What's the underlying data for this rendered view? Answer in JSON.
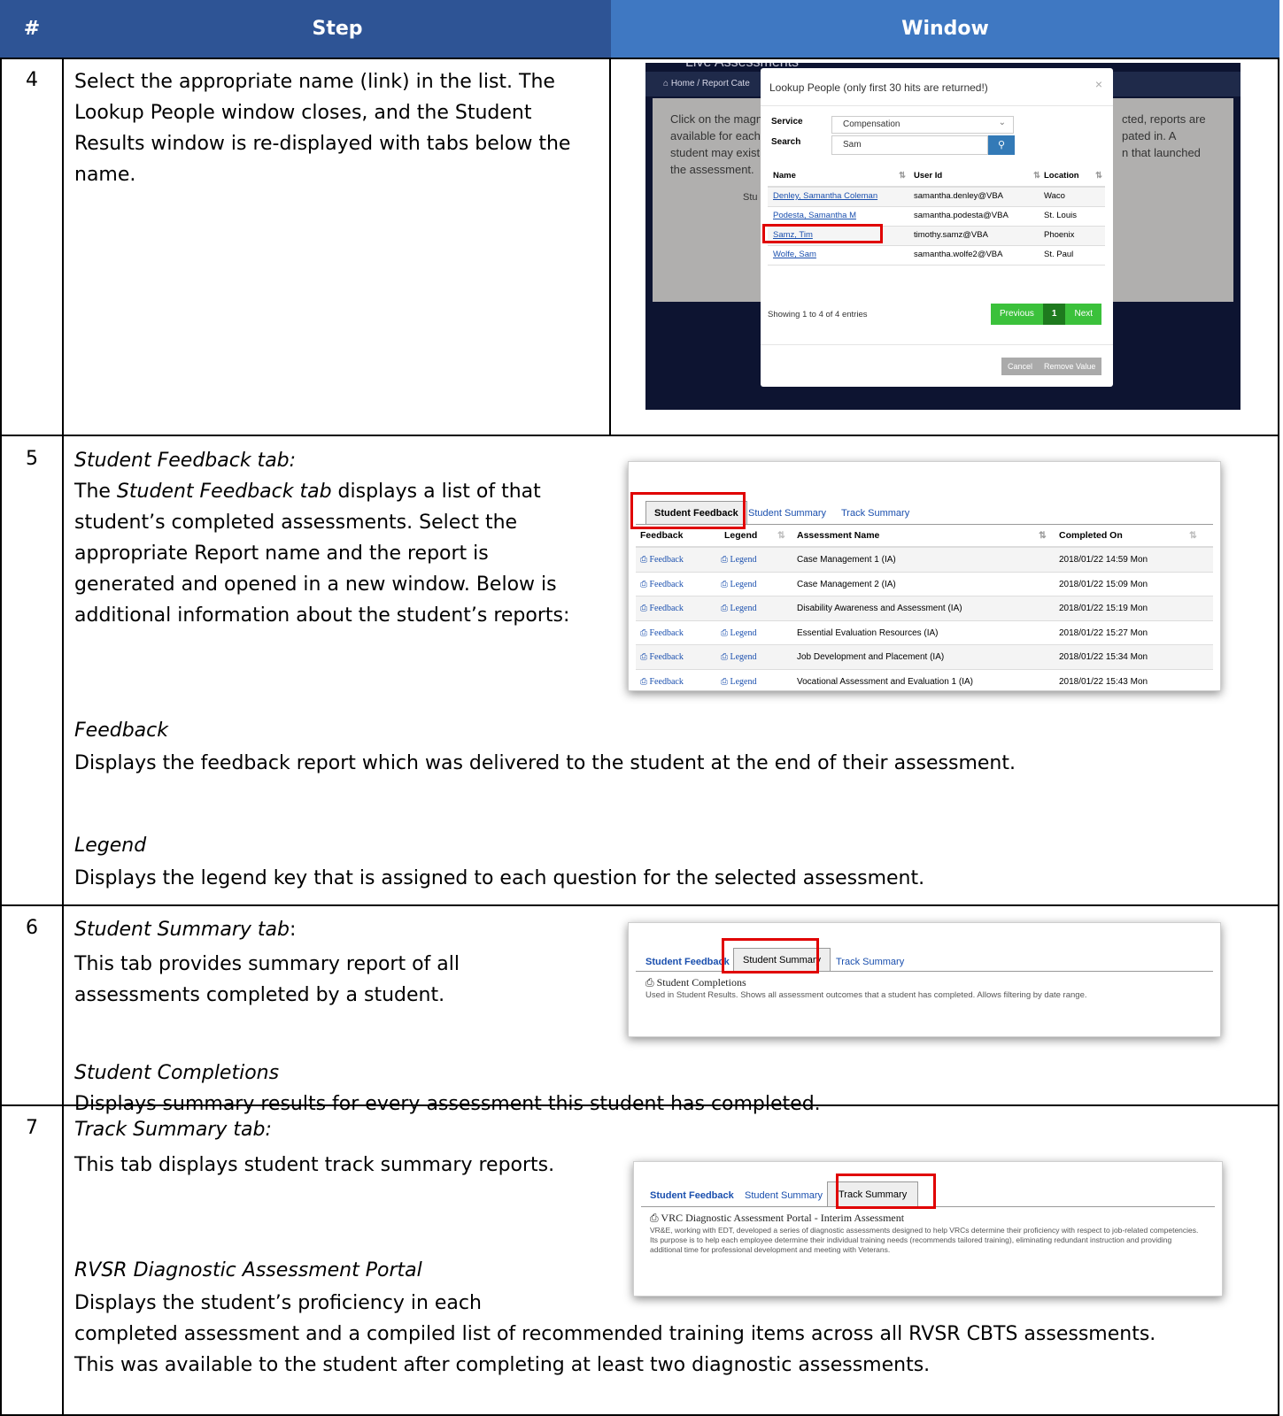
{
  "header": {
    "num": "#",
    "step": "Step",
    "window": "Window"
  },
  "rows": [
    {
      "num": "4",
      "text": "Select the appropriate name (link) in the list.  The Lookup People window closes, and the Student Results window is re-displayed with tabs below the name.",
      "screenshot": {
        "bg_title": "Live Assessments",
        "breadcrumb": "Home  /  Report Cate",
        "bg_text": [
          "Click on the magn",
          "available for each",
          "student may exist",
          "the assessment."
        ],
        "bg_text_right": [
          "cted, reports are",
          "pated in. A",
          "n that launched"
        ],
        "bg_stub": "Stu",
        "modal_title": "Lookup People (only first 30 hits are returned!)",
        "close": "×",
        "service_label": "Service",
        "service_value": "Compensation",
        "search_label": "Search",
        "search_value": "Sam",
        "columns": [
          "Name",
          "User Id",
          "Location"
        ],
        "people": [
          {
            "name": "Denley, Samantha Coleman",
            "user": "samantha.denley@VBA",
            "loc": "Waco"
          },
          {
            "name": "Podesta, Samantha M",
            "user": "samantha.podesta@VBA",
            "loc": "St. Louis"
          },
          {
            "name": "Samz, Tim",
            "user": "timothy.samz@VBA",
            "loc": "Phoenix"
          },
          {
            "name": "Wolfe, Sam",
            "user": "samantha.wolfe2@VBA",
            "loc": "St. Paul"
          }
        ],
        "showing": "Showing 1 to 4 of 4 entries",
        "prev": "Previous",
        "page": "1",
        "next": "Next",
        "cancel": "Cancel",
        "remove": "Remove Value"
      }
    },
    {
      "num": "5",
      "tab_title": "Student Feedback tab:",
      "text_pre": "The ",
      "text_ital": "Student Feedback tab",
      "text_post": " displays a list of that student’s completed assessments.  Select the appropriate Report name and the report is generated and opened in a new window.  Below is additional information about the student’s reports:",
      "sub1_title": "Feedback",
      "sub1_text": "Displays the feedback report which was delivered to the student at the end of their assessment.",
      "sub2_title": "Legend",
      "sub2_text": "Displays the legend key that is assigned to each question for the selected assessment.",
      "screenshot": {
        "tabs": [
          "Student Feedback",
          "Student Summary",
          "Track Summary"
        ],
        "columns": [
          "Feedback",
          "Legend",
          "Assessment Name",
          "Completed On"
        ],
        "rows": [
          {
            "fb": "Feedback",
            "lg": "Legend",
            "name": "Case Management 1 (IA)",
            "date": "2018/01/22 14:59 Mon"
          },
          {
            "fb": "Feedback",
            "lg": "Legend",
            "name": "Case Management 2 (IA)",
            "date": "2018/01/22 15:09 Mon"
          },
          {
            "fb": "Feedback",
            "lg": "Legend",
            "name": "Disability Awareness and Assessment (IA)",
            "date": "2018/01/22 15:19 Mon"
          },
          {
            "fb": "Feedback",
            "lg": "Legend",
            "name": "Essential Evaluation Resources (IA)",
            "date": "2018/01/22 15:27 Mon"
          },
          {
            "fb": "Feedback",
            "lg": "Legend",
            "name": "Job Development and Placement (IA)",
            "date": "2018/01/22 15:34 Mon"
          },
          {
            "fb": "Feedback",
            "lg": "Legend",
            "name": "Vocational Assessment and Evaluation 1 (IA)",
            "date": "2018/01/22 15:43 Mon"
          }
        ]
      }
    },
    {
      "num": "6",
      "tab_title": "Student Summary tab",
      "tab_colon": ":",
      "text": "This tab provides summary report of all assessments completed by a student.",
      "sub_title": "Student Completions",
      "sub_text": "Displays summary results for every assessment this student has completed.",
      "screenshot": {
        "tabs": [
          "Student Feedback",
          "Student Summary",
          "Track Summary"
        ],
        "item_title": "Student Completions",
        "item_desc": "Used in Student Results. Shows all assessment outcomes that a student has completed. Allows filtering by date range."
      }
    },
    {
      "num": "7",
      "tab_title": "Track Summary tab:",
      "text": "This tab displays student track summary reports.",
      "sub_title": "RVSR Diagnostic Assessment Portal",
      "sub_text1": "Displays the student’s proficiency in each",
      "sub_text2": "completed assessment and a compiled list of recommended training items across all RVSR CBTS assessments.",
      "sub_text3": "This was available to the student after completing at least two diagnostic assessments.",
      "screenshot": {
        "tabs": [
          "Student Feedback",
          "Student Summary",
          "Track Summary"
        ],
        "item_title": "VRC Diagnostic Assessment Portal - Interim Assessment",
        "item_desc": "VR&E, working with EDT, developed a series of diagnostic assessments designed to help VRCs determine their proficiency with respect to job-related competencies. Its purpose is to help each employee determine their individual training needs (recommends tailored training), eliminating redundant instruction and providing additional time for professional development and meeting with Veterans."
      }
    }
  ]
}
